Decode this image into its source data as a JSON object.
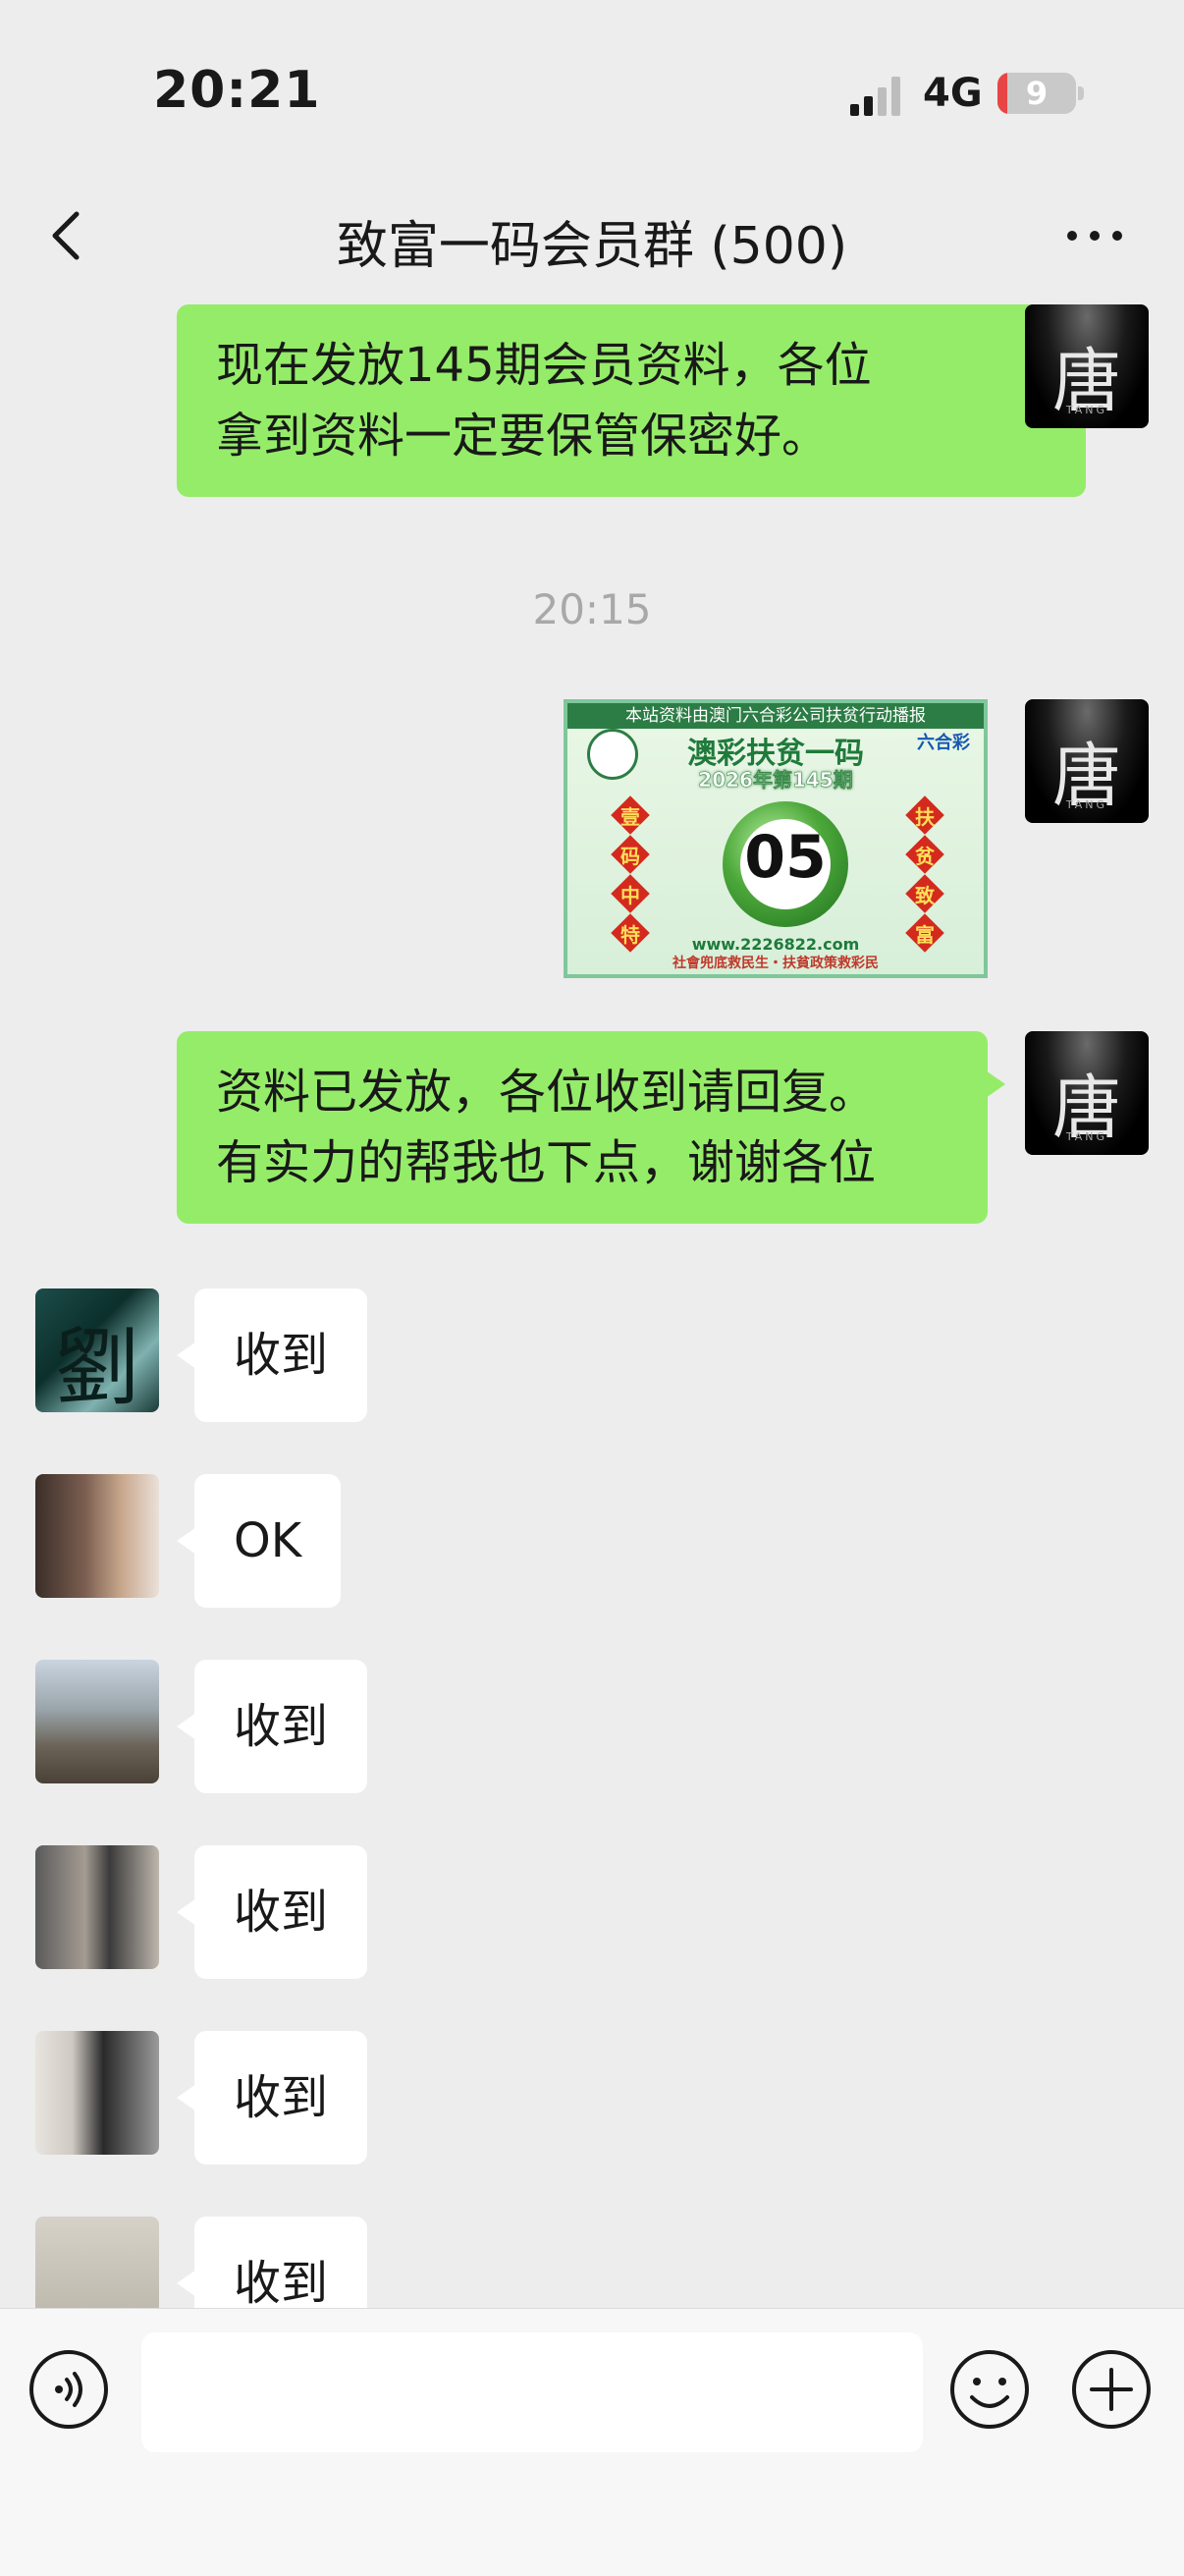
{
  "status": {
    "time": "20:21",
    "network": "4G",
    "battery": "9"
  },
  "nav": {
    "title": "致富一码会员群 (500)"
  },
  "chat": {
    "messages_me": [
      {
        "line1": "现在发放145期会员资料，各位",
        "line2": "拿到资料一定要保管保密好。"
      },
      {
        "line1": "资料已发放，各位收到请回复。",
        "line2": "有实力的帮我也下点，谢谢各位"
      }
    ],
    "time_separator": "20:15",
    "card": {
      "banner": "本站资料由澳门六合彩公司扶贫行动播报",
      "title": "澳彩扶贫一码",
      "issue": "2026年第145期",
      "logo_right": "六合彩",
      "left_chars": [
        "壹",
        "码",
        "中",
        "特"
      ],
      "right_chars": [
        "扶",
        "贫",
        "致",
        "富"
      ],
      "number": "05",
      "url": "www.2226822.com",
      "slogan": "社會兜底救民生・扶貧政策救彩民"
    },
    "replies": [
      "收到",
      "OK",
      "收到",
      "收到",
      "收到",
      "收到"
    ],
    "tang_avatar": {
      "char": "唐",
      "sub": "TANG"
    },
    "liu_avatar_char": "劉"
  },
  "input": {
    "placeholder": ""
  },
  "colors": {
    "bubble_me": "#95ec69",
    "bubble_other": "#ffffff",
    "background": "#ededed"
  }
}
